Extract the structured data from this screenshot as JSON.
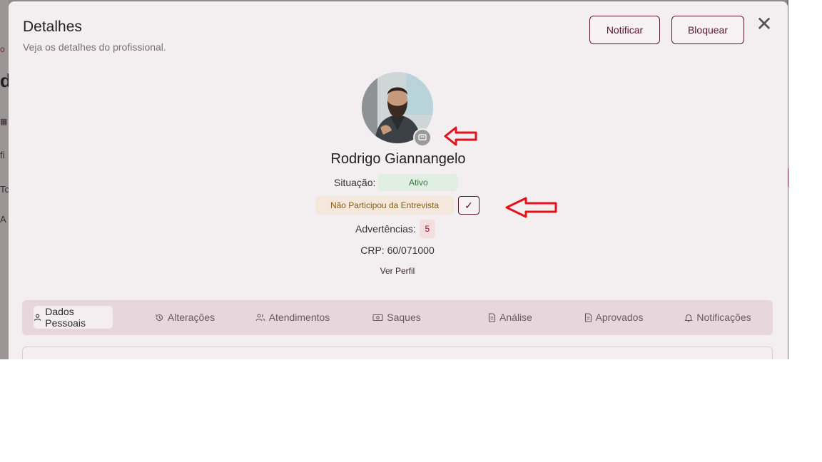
{
  "background": {
    "fragments": [
      "o",
      "d",
      "fi",
      "Tc",
      "A"
    ]
  },
  "modal": {
    "title": "Detalhes",
    "subtitle": "Veja os detalhes do profissional.",
    "notify_label": "Notificar",
    "block_label": "Bloquear",
    "close_glyph": "✕"
  },
  "profile": {
    "name": "Rodrigo Giannangelo",
    "status_label": "Situação:",
    "status_value": "Ativo",
    "interview_status": "Não Participou da Entrevista",
    "check_glyph": "✓",
    "warnings_label": "Advertências:",
    "warnings_count": "5",
    "crp": "CRP: 60/071000",
    "view_profile": "Ver Perfil"
  },
  "tabs": [
    {
      "label": "Dados Pessoais",
      "icon": "user-icon",
      "active": true
    },
    {
      "label": "Alterações",
      "icon": "history-icon",
      "active": false
    },
    {
      "label": "Atendimentos",
      "icon": "users-icon",
      "active": false
    },
    {
      "label": "Saques",
      "icon": "money-icon",
      "active": false
    },
    {
      "label": "Análise",
      "icon": "document-icon",
      "active": false
    },
    {
      "label": "Aprovados",
      "icon": "document-icon",
      "active": false
    },
    {
      "label": "Notificações",
      "icon": "bell-icon",
      "active": false
    }
  ],
  "colors": {
    "brand": "#5e1530",
    "annotation_arrow": "#e4121b",
    "active_badge_bg": "#e0efe2",
    "interview_badge_bg": "#f4e7dc",
    "warning_badge_bg": "#f5dede"
  }
}
